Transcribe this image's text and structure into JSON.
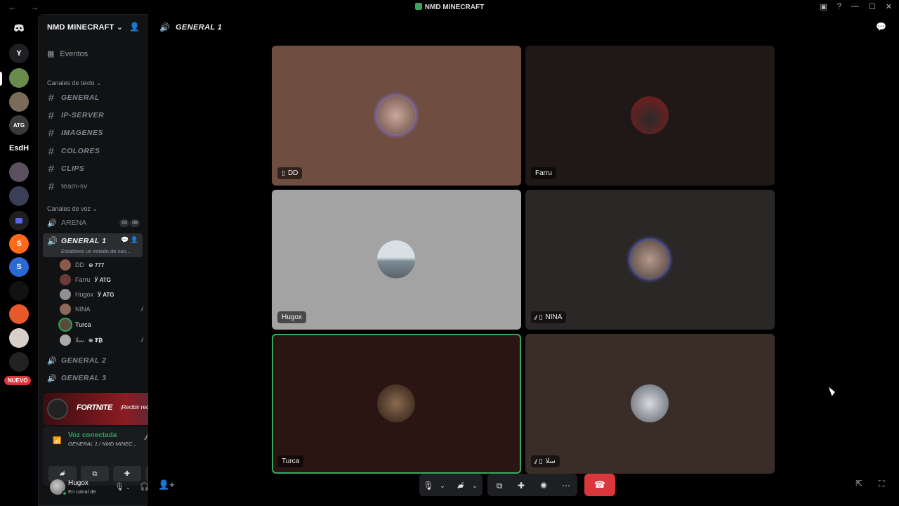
{
  "window": {
    "title": "NMD MINECRAFT",
    "nav": "← →",
    "controls": [
      "▣",
      "?",
      "—",
      "☐",
      "✕"
    ]
  },
  "rail": {
    "servers": [
      {
        "label": "",
        "icon": "discord-logo-icon",
        "color": "#1e1f22"
      },
      {
        "label": "Y",
        "color": "#1e1f22"
      },
      {
        "label": "",
        "color": "#6a8b4b"
      },
      {
        "label": "",
        "color": "#7b6b5a"
      },
      {
        "label": "ATG",
        "color": "#3a3a3a"
      },
      {
        "label": "EsdH",
        "color": "#000000"
      },
      {
        "label": "",
        "color": "#5a5060"
      },
      {
        "label": "",
        "color": "#3b3f55"
      },
      {
        "label": "",
        "color": "#5865f2"
      },
      {
        "label": "S",
        "color": "#ff6a1a"
      },
      {
        "label": "S",
        "color": "#2b6ad6"
      },
      {
        "label": "",
        "color": "#111111"
      },
      {
        "label": "",
        "color": "#e8592a"
      },
      {
        "label": "",
        "color": "#d9cfc9"
      },
      {
        "label": "",
        "color": "#222222"
      }
    ],
    "nuevo": "NUEVO"
  },
  "sidebar": {
    "guild_name": "NMD MINECRAFT",
    "events": "Eventos",
    "text_category": "Canales de texto",
    "text_channels": [
      "GENERAL",
      "IP-SERVER",
      "IMAGENES",
      "COLORES",
      "CLIPS",
      "team-sv"
    ],
    "voice_category": "Canales de voz",
    "voice_channels": {
      "arena": {
        "name": "ARENA",
        "badges": [
          "00",
          "08"
        ]
      },
      "active": {
        "name": "GENERAL 1",
        "status": "Establece un estado de can..."
      },
      "general2": "GENERAL 2",
      "general3": "GENERAL 3"
    },
    "voice_users": [
      {
        "name": "DD",
        "tag": "⊕ 777",
        "color": "#8a5a4a"
      },
      {
        "name": "Farru",
        "tag": "Ӱ ATG",
        "color": "#6a3a3a"
      },
      {
        "name": "Hugox",
        "tag": "Ӱ ATG",
        "color": "#909090"
      },
      {
        "name": "NINA",
        "tag": "",
        "color": "#8a6a5a"
      },
      {
        "name": "Turca",
        "tag": "",
        "color": "#5a4a3a"
      },
      {
        "name": "ﺳﻠﺎ",
        "tag": "⊕ ₮₿",
        "color": "#aaaaaa"
      }
    ],
    "promo": {
      "brand": "FORTNITE",
      "cta": "¡Recibir recompens..."
    },
    "voice_panel": {
      "title": "Voz conectada",
      "sub": "GENERAL 1 / NMD MINEC..."
    },
    "user": {
      "name": "Hugox",
      "status": "En canal de"
    }
  },
  "main": {
    "channel": "GENERAL 1",
    "tiles": [
      {
        "name": "DD",
        "bg": "#6f4d40",
        "avatar": "#9a7f72",
        "phone": true,
        "muted": false
      },
      {
        "name": "Farru",
        "bg": "#1f1816",
        "avatar": "#5a2020",
        "phone": false,
        "muted": false
      },
      {
        "name": "Hugox",
        "bg": "#a3a3a3",
        "avatar": "#8aa0b0",
        "phone": false,
        "muted": false
      },
      {
        "name": "NINA",
        "bg": "#2a2727",
        "avatar": "#7a6a62",
        "phone": true,
        "muted": true
      },
      {
        "name": "Turca",
        "bg": "#2b1512",
        "avatar": "#5b4535",
        "phone": false,
        "muted": false,
        "speaking": true
      },
      {
        "name": "ﺳﻠﺎ",
        "bg": "#3a2d28",
        "avatar": "#9aa0a8",
        "phone": true,
        "muted": true
      }
    ]
  },
  "colors": {
    "accent_green": "#23a55a",
    "leave_red": "#da373c",
    "brand": "#5865f2"
  }
}
